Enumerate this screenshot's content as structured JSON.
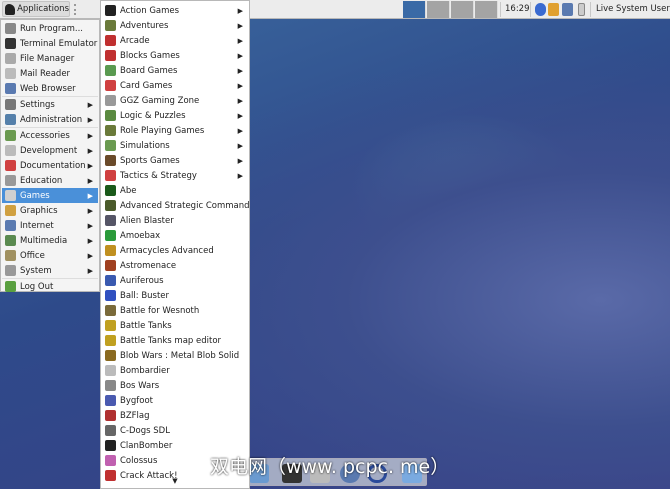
{
  "topbar": {
    "applications_label": "Applications",
    "clock": "16:29",
    "user": "Live System User",
    "workspaces": 4,
    "active_workspace": 1,
    "tray_icons": [
      "bluetooth-icon",
      "package-updater-icon",
      "network-icon",
      "battery-icon"
    ]
  },
  "main_menu": {
    "groups": [
      [
        {
          "label": "Run Program...",
          "icon": "run-icon",
          "color": "#888"
        },
        {
          "label": "Terminal Emulator",
          "icon": "terminal-icon",
          "color": "#333"
        },
        {
          "label": "File Manager",
          "icon": "file-manager-icon",
          "color": "#aaa"
        },
        {
          "label": "Mail Reader",
          "icon": "mail-icon",
          "color": "#bbb"
        },
        {
          "label": "Web Browser",
          "icon": "web-browser-icon",
          "color": "#5a7ab0"
        }
      ],
      [
        {
          "label": "Settings",
          "icon": "settings-icon",
          "color": "#777",
          "sub": true
        },
        {
          "label": "Administration",
          "icon": "administration-icon",
          "color": "#5580aa",
          "sub": true
        }
      ],
      [
        {
          "label": "Accessories",
          "icon": "accessories-icon",
          "color": "#6a9a50",
          "sub": true
        },
        {
          "label": "Development",
          "icon": "development-icon",
          "color": "#bbb",
          "sub": true
        },
        {
          "label": "Documentation",
          "icon": "documentation-icon",
          "color": "#d04040",
          "sub": true
        },
        {
          "label": "Education",
          "icon": "education-icon",
          "color": "#999",
          "sub": true
        },
        {
          "label": "Games",
          "icon": "games-icon",
          "color": "#d0d0d0",
          "sub": true,
          "selected": true
        },
        {
          "label": "Graphics",
          "icon": "graphics-icon",
          "color": "#d0a040",
          "sub": true
        },
        {
          "label": "Internet",
          "icon": "internet-icon",
          "color": "#5a7ab0",
          "sub": true
        },
        {
          "label": "Multimedia",
          "icon": "multimedia-icon",
          "color": "#5a8a50",
          "sub": true
        },
        {
          "label": "Office",
          "icon": "office-icon",
          "color": "#a09060",
          "sub": true
        },
        {
          "label": "System",
          "icon": "system-icon",
          "color": "#999",
          "sub": true
        }
      ],
      [
        {
          "label": "Log Out",
          "icon": "log-out-icon",
          "color": "#5aa040"
        }
      ]
    ]
  },
  "games_menu": {
    "items": [
      {
        "label": "Action Games",
        "sub": true,
        "icon": "bomb-icon",
        "color": "#222"
      },
      {
        "label": "Adventures",
        "sub": true,
        "icon": "adventures-icon",
        "color": "#6a7a3a"
      },
      {
        "label": "Arcade",
        "sub": true,
        "icon": "joystick-icon",
        "color": "#c03030"
      },
      {
        "label": "Blocks Games",
        "sub": true,
        "icon": "blocks-icon",
        "color": "#c03030"
      },
      {
        "label": "Board Games",
        "sub": true,
        "icon": "board-icon",
        "color": "#5a9a50"
      },
      {
        "label": "Card Games",
        "sub": true,
        "icon": "cards-icon",
        "color": "#d04040"
      },
      {
        "label": "GGZ Gaming Zone",
        "sub": true,
        "icon": "ggz-icon",
        "color": "#999"
      },
      {
        "label": "Logic & Puzzles",
        "sub": true,
        "icon": "puzzle-icon",
        "color": "#5a8a40"
      },
      {
        "label": "Role Playing Games",
        "sub": true,
        "icon": "rpg-icon",
        "color": "#6a7a3a"
      },
      {
        "label": "Simulations",
        "sub": true,
        "icon": "simulations-icon",
        "color": "#6a9a50"
      },
      {
        "label": "Sports Games",
        "sub": true,
        "icon": "sports-icon",
        "color": "#6a4a2a"
      },
      {
        "label": "Tactics & Strategy",
        "sub": true,
        "icon": "strategy-icon",
        "color": "#d04040"
      },
      {
        "label": "Abe",
        "icon": "abe-icon",
        "color": "#1a5a1a"
      },
      {
        "label": "Advanced Strategic Command",
        "icon": "asc-icon",
        "color": "#4a5a2a"
      },
      {
        "label": "Alien Blaster",
        "icon": "alien-blaster-icon",
        "color": "#556"
      },
      {
        "label": "Amoebax",
        "icon": "amoebax-icon",
        "color": "#2a9a3a"
      },
      {
        "label": "Armacycles Advanced",
        "icon": "armacycles-icon",
        "color": "#c09020"
      },
      {
        "label": "Astromenace",
        "icon": "astromenace-icon",
        "color": "#a04020"
      },
      {
        "label": "Auriferous",
        "icon": "auriferous-icon",
        "color": "#3a5ab0"
      },
      {
        "label": "Ball: Buster",
        "icon": "ball-buster-icon",
        "color": "#3050c0"
      },
      {
        "label": "Battle for Wesnoth",
        "icon": "wesnoth-icon",
        "color": "#7a6a3a"
      },
      {
        "label": "Battle Tanks",
        "icon": "battle-tanks-icon",
        "color": "#c0a020"
      },
      {
        "label": "Battle Tanks map editor",
        "icon": "map-editor-icon",
        "color": "#c0a020"
      },
      {
        "label": "Blob Wars : Metal Blob Solid",
        "icon": "blob-wars-icon",
        "color": "#8a6a20"
      },
      {
        "label": "Bombardier",
        "icon": "bombardier-icon",
        "color": "#bbb"
      },
      {
        "label": "Bos Wars",
        "icon": "bos-wars-icon",
        "color": "#888"
      },
      {
        "label": "Bygfoot",
        "icon": "bygfoot-icon",
        "color": "#4a5ab0"
      },
      {
        "label": "BZFlag",
        "icon": "bzflag-icon",
        "color": "#b03030"
      },
      {
        "label": "C-Dogs SDL",
        "icon": "c-dogs-icon",
        "color": "#666"
      },
      {
        "label": "ClanBomber",
        "icon": "clanbomber-icon",
        "color": "#222"
      },
      {
        "label": "Colossus",
        "icon": "colossus-icon",
        "color": "#c060b0"
      },
      {
        "label": "Crack Attack!",
        "icon": "crack-attack-icon",
        "color": "#c03030"
      }
    ]
  },
  "watermark": "双电网（www. pcpc. me）"
}
